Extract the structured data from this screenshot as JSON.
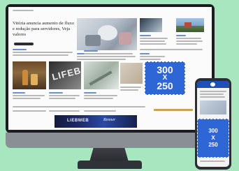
{
  "article": {
    "headline": "Vitória anuncia aumento de fluxo e redução para servidores, Veja valores",
    "section_label": "Macroeconomia"
  },
  "desktop_ad": {
    "width": "300",
    "times": "X",
    "height": "250"
  },
  "mobile_ad": {
    "width": "300",
    "times": "X",
    "height": "250"
  },
  "leaderboard": {
    "brand_left": "LIEBWEB",
    "brand_right": "Renner"
  },
  "billboard_text": "LIFEB",
  "colors": {
    "background": "#a8e6c0",
    "ad_blue": "#2f66d6",
    "bezel": "#1a1c1f"
  }
}
